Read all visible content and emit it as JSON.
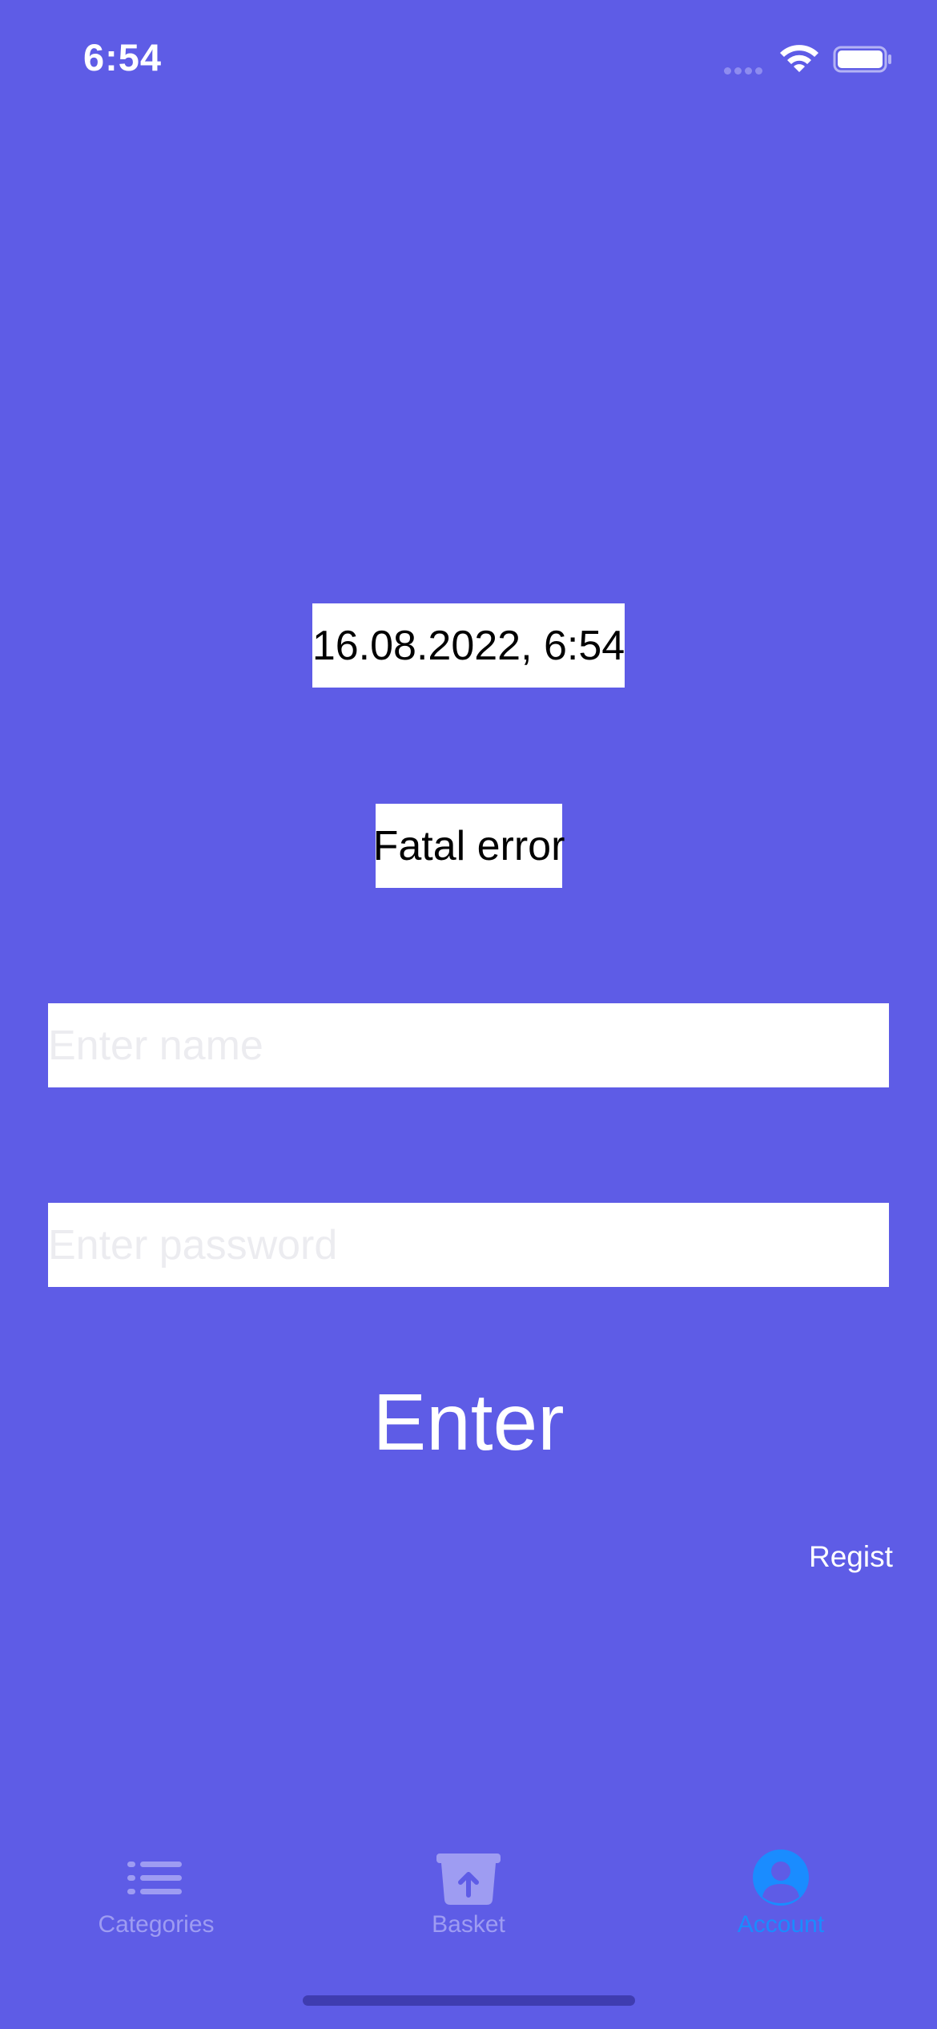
{
  "status_bar": {
    "time": "6:54"
  },
  "main": {
    "date_time": "16.08.2022, 6:54",
    "error_message": "Fatal error",
    "name_input": {
      "value": "",
      "placeholder": "Enter name"
    },
    "password_input": {
      "value": "",
      "placeholder": "Enter password"
    },
    "enter_label": "Enter",
    "register_label": "Regist"
  },
  "tab_bar": {
    "tabs": [
      {
        "label": "Categories",
        "icon": "list-icon",
        "active": false
      },
      {
        "label": "Basket",
        "icon": "basket-icon",
        "active": false
      },
      {
        "label": "Account",
        "icon": "person-icon",
        "active": true
      }
    ]
  },
  "colors": {
    "background": "#5e5ce6",
    "tab_inactive": "#9e9cf2",
    "tab_active": "#1a8cff",
    "box_background": "#ffffff"
  }
}
